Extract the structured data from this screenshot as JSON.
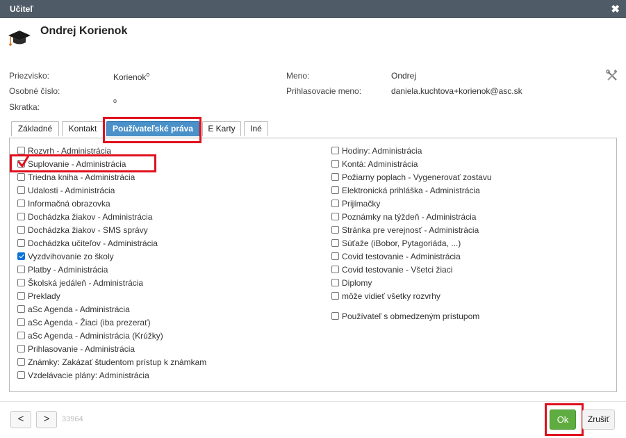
{
  "dialog": {
    "title": "Učiteľ",
    "close_glyph": "✖"
  },
  "header": {
    "name": "Ondrej Korienok",
    "icon": "graduation-cap-icon"
  },
  "fields": {
    "surname_label": "Priezvisko:",
    "surname_value": "Korienok",
    "surname_mark": "o",
    "personal_number_label": "Osobné číslo:",
    "abbr_label": "Skratka:",
    "abbr_mark": "o",
    "first_name_label": "Meno:",
    "first_name_value": "Ondrej",
    "login_label": "Prihlasovacie meno:",
    "login_value": "daniela.kuchtova+korienok@asc.sk"
  },
  "tabs": [
    {
      "label": "Základné",
      "active": false
    },
    {
      "label": "Kontakt",
      "active": false
    },
    {
      "label": "Používateľské práva",
      "active": true
    },
    {
      "label": "E Karty",
      "active": false
    },
    {
      "label": "Iné",
      "active": false
    }
  ],
  "permissions_left": [
    {
      "label": "Rozvrh - Administrácia",
      "checked": false
    },
    {
      "label": "Suplovanie - Administrácia",
      "checked": false,
      "red_check": true
    },
    {
      "label": "Triedna kniha - Administrácia",
      "checked": false
    },
    {
      "label": "Udalosti - Administrácia",
      "checked": false
    },
    {
      "label": "Informačná obrazovka",
      "checked": false
    },
    {
      "label": "Dochádzka žiakov - Administrácia",
      "checked": false
    },
    {
      "label": "Dochádzka žiakov - SMS správy",
      "checked": false
    },
    {
      "label": "Dochádzka učiteľov - Administrácia",
      "checked": false
    },
    {
      "label": "Vyzdvihovanie zo školy",
      "checked": true
    },
    {
      "label": "Platby - Administrácia",
      "checked": false
    },
    {
      "label": "Školská jedáleň - Administrácia",
      "checked": false
    },
    {
      "label": "Preklady",
      "checked": false
    },
    {
      "label": "aSc Agenda - Administrácia",
      "checked": false
    },
    {
      "label": "aSc Agenda - Žiaci (iba prezerať)",
      "checked": false
    },
    {
      "label": "aSc Agenda - Administrácia (Krúžky)",
      "checked": false
    },
    {
      "label": "Prihlasovanie - Administrácia",
      "checked": false
    },
    {
      "label": "Známky: Zakázať študentom prístup k známkam",
      "checked": false
    },
    {
      "label": "Vzdelávacie plány: Administrácia",
      "checked": false
    }
  ],
  "permissions_right": [
    {
      "label": "Hodiny: Administrácia",
      "checked": false
    },
    {
      "label": "Kontá: Administrácia",
      "checked": false
    },
    {
      "label": "Požiarny poplach - Vygenerovať zostavu",
      "checked": false
    },
    {
      "label": "Elektronická prihláška - Administrácia",
      "checked": false
    },
    {
      "label": "Prijímačky",
      "checked": false
    },
    {
      "label": "Poznámky na týždeň - Administrácia",
      "checked": false
    },
    {
      "label": "Stránka pre verejnosť - Administrácia",
      "checked": false
    },
    {
      "label": "Súťaže (iBobor, Pytagoriáda, ...)",
      "checked": false
    },
    {
      "label": "Covid testovanie - Administrácia",
      "checked": false
    },
    {
      "label": "Covid testovanie - Všetci žiaci",
      "checked": false
    },
    {
      "label": "Diplomy",
      "checked": false
    },
    {
      "label": "môže vidieť všetky rozvrhy",
      "checked": false
    }
  ],
  "permission_restricted": {
    "label": "Používateľ s obmedzeným prístupom",
    "checked": false
  },
  "footer": {
    "prev": "<",
    "next": ">",
    "record_id": "33964",
    "ok_label": "Ok",
    "cancel_label": "Zrušiť"
  },
  "colors": {
    "title_bar": "#4f5b66",
    "tab_active": "#4a90c9",
    "ok_button": "#5fad41",
    "highlight": "#e0101d",
    "checkbox_checked": "#0b72d9"
  }
}
